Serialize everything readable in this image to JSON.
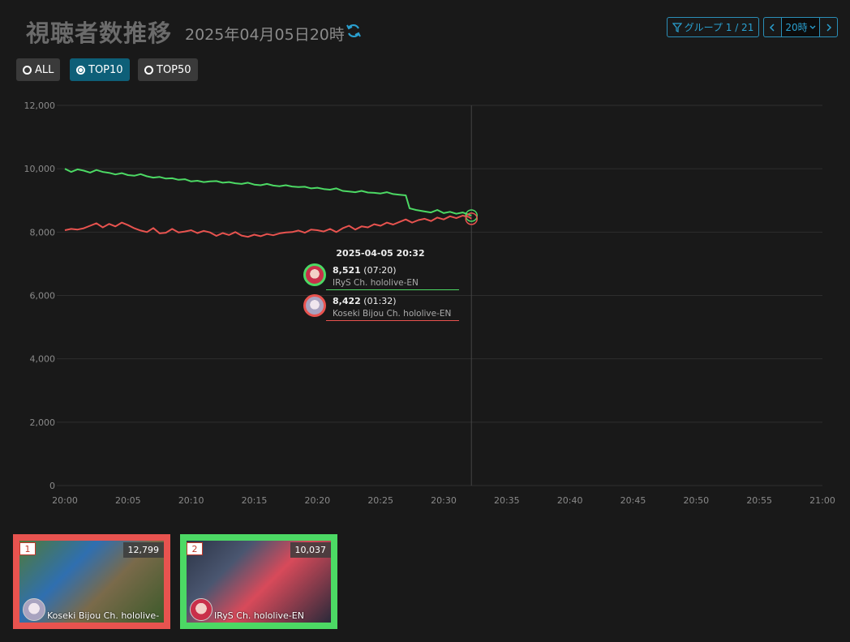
{
  "header": {
    "title": "視聴者数推移",
    "subtitle": "2025年04月05日20時",
    "refresh_icon": "refresh-icon"
  },
  "controls": {
    "group_label": "グループ 1 / 21",
    "prev_icon": "chevron-left-icon",
    "next_icon": "chevron-right-icon",
    "hour_label": "20時",
    "filter_icon": "filter-icon"
  },
  "filters": [
    {
      "label": "ALL",
      "selected": false
    },
    {
      "label": "TOP10",
      "selected": true
    },
    {
      "label": "TOP50",
      "selected": false
    }
  ],
  "colors": {
    "accent": "#2aa0d0",
    "irys": "#4cd964",
    "bijou": "#e8534f",
    "background": "#191919"
  },
  "chart_data": {
    "type": "line",
    "ylim": [
      0,
      12000
    ],
    "yticks": [
      "0",
      "2,000",
      "4,000",
      "6,000",
      "8,000",
      "10,000",
      "12,000"
    ],
    "xticks": [
      "20:00",
      "20:05",
      "20:10",
      "20:15",
      "20:20",
      "20:25",
      "20:30",
      "20:35",
      "20:40",
      "20:45",
      "20:50",
      "20:55",
      "21:00"
    ],
    "xlim_minutes": [
      0,
      60
    ],
    "cursor_minute": 32.2,
    "grid": true,
    "series": [
      {
        "name": "IRyS Ch. hololive-EN",
        "color": "#4cd964",
        "x": [
          0,
          0.5,
          1,
          1.5,
          2,
          2.5,
          3,
          3.5,
          4,
          4.5,
          5,
          5.5,
          6,
          6.5,
          7,
          7.5,
          8,
          8.5,
          9,
          9.5,
          10,
          10.5,
          11,
          11.5,
          12,
          12.5,
          13,
          13.5,
          14,
          14.5,
          15,
          15.5,
          16,
          16.5,
          17,
          17.5,
          18,
          18.5,
          19,
          19.5,
          20,
          20.5,
          21,
          21.5,
          22,
          22.5,
          23,
          23.5,
          24,
          24.5,
          25,
          25.5,
          26,
          26.5,
          27,
          27.3,
          27.8,
          28.5,
          29,
          29.5,
          30,
          30.5,
          31,
          31.5,
          32,
          32.2
        ],
        "values": [
          10000,
          9900,
          9980,
          9940,
          9880,
          9960,
          9900,
          9870,
          9820,
          9860,
          9800,
          9780,
          9830,
          9760,
          9720,
          9740,
          9690,
          9700,
          9650,
          9670,
          9600,
          9620,
          9580,
          9600,
          9610,
          9560,
          9580,
          9540,
          9520,
          9560,
          9500,
          9480,
          9520,
          9470,
          9450,
          9480,
          9440,
          9420,
          9430,
          9380,
          9400,
          9360,
          9340,
          9380,
          9300,
          9280,
          9260,
          9300,
          9250,
          9240,
          9220,
          9260,
          9200,
          9180,
          9160,
          8750,
          8700,
          8650,
          8620,
          8700,
          8600,
          8640,
          8580,
          8620,
          8550,
          8521
        ]
      },
      {
        "name": "Koseki Bijou Ch. hololive-",
        "color": "#e8534f",
        "x": [
          0,
          0.5,
          1,
          1.5,
          2,
          2.5,
          3,
          3.5,
          4,
          4.5,
          5,
          5.5,
          6,
          6.5,
          7,
          7.5,
          8,
          8.5,
          9,
          9.5,
          10,
          10.5,
          11,
          11.5,
          12,
          12.5,
          13,
          13.5,
          14,
          14.5,
          15,
          15.5,
          16,
          16.5,
          17,
          17.5,
          18,
          18.5,
          19,
          19.5,
          20,
          20.5,
          21,
          21.5,
          22,
          22.5,
          23,
          23.5,
          24,
          24.5,
          25,
          25.5,
          26,
          26.5,
          27,
          27.5,
          28,
          28.5,
          29,
          29.5,
          30,
          30.5,
          31,
          31.5,
          32,
          32.2
        ],
        "values": [
          8060,
          8100,
          8080,
          8120,
          8200,
          8280,
          8150,
          8260,
          8180,
          8300,
          8220,
          8120,
          8050,
          8000,
          8130,
          7960,
          7980,
          8100,
          7990,
          8020,
          8060,
          7970,
          8040,
          7990,
          7880,
          7970,
          7910,
          8000,
          7890,
          7850,
          7920,
          7870,
          7940,
          7900,
          7960,
          7990,
          8000,
          8050,
          7980,
          8080,
          8060,
          8020,
          8100,
          8000,
          8120,
          8200,
          8080,
          8180,
          8150,
          8250,
          8200,
          8300,
          8240,
          8320,
          8400,
          8300,
          8380,
          8420,
          8350,
          8460,
          8400,
          8500,
          8440,
          8520,
          8480,
          8422
        ]
      }
    ],
    "tooltip": {
      "title": "2025-04-05 20:32",
      "rows": [
        {
          "value": "8,521",
          "duration": "(07:20)",
          "name": "IRyS Ch. hololive-EN",
          "color": "#4cd964"
        },
        {
          "value": "8,422",
          "duration": "(01:32)",
          "name": "Koseki Bijou Ch. hololive-EN",
          "color": "#e8534f"
        }
      ]
    }
  },
  "cards": [
    {
      "rank": "1",
      "count": "12,799",
      "name": "Koseki Bijou Ch. hololive-",
      "border": "#e8534f"
    },
    {
      "rank": "2",
      "count": "10,037",
      "name": "IRyS Ch. hololive-EN",
      "border": "#4cd964"
    }
  ]
}
